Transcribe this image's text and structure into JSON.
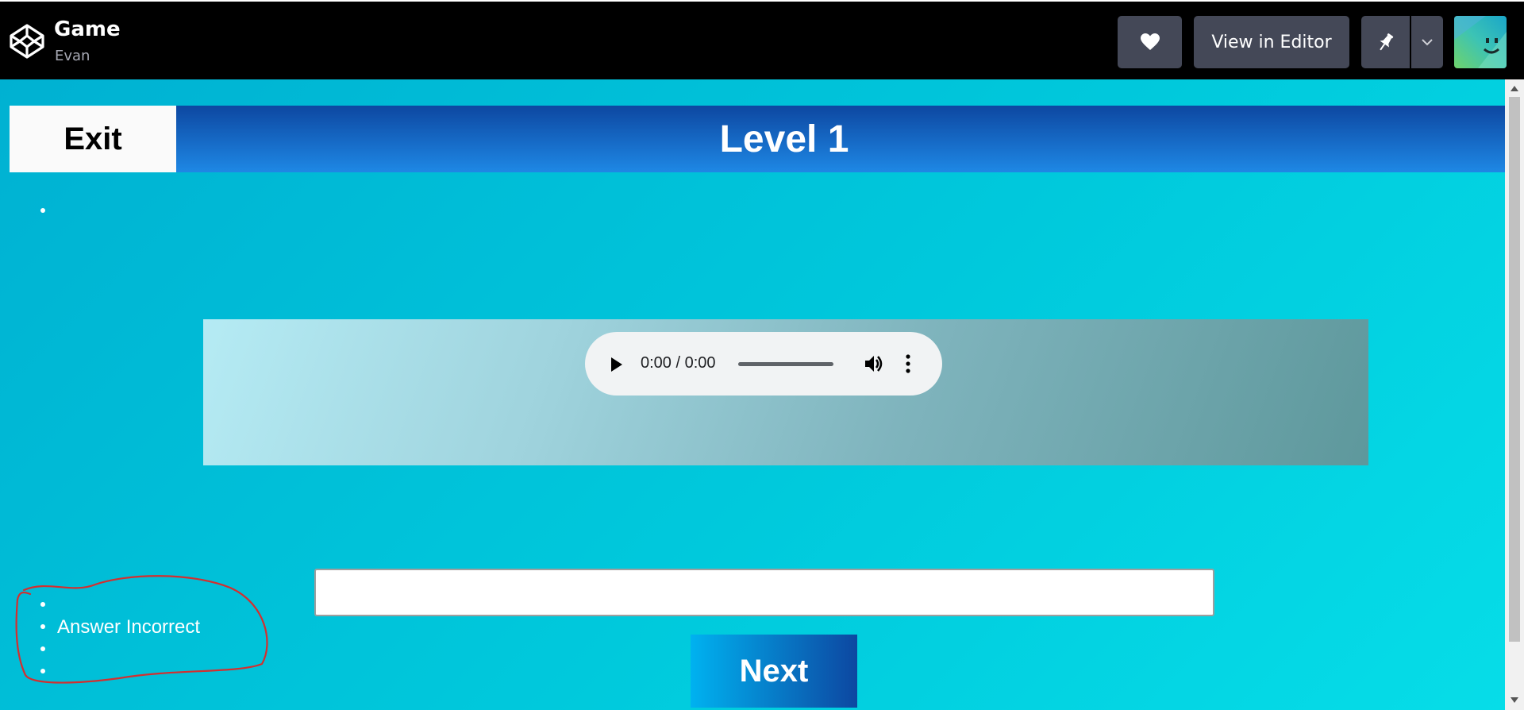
{
  "topbar": {
    "title": "Game",
    "author": "Evan",
    "heart_icon": "heart-icon",
    "view_in_editor": "View in Editor",
    "pin_icon": "pin-icon",
    "dropdown_icon": "chevron-down-icon"
  },
  "game": {
    "exit_label": "Exit",
    "level_title": "Level 1",
    "audio": {
      "time": "0:00 / 0:00"
    },
    "answer_input": {
      "value": "",
      "placeholder": ""
    },
    "next_label": "Next",
    "feedback": {
      "items": [
        "",
        "Answer Incorrect",
        "",
        ""
      ]
    }
  },
  "colors": {
    "topbar_bg": "#000000",
    "button_bg": "#444857",
    "stage_bg": "#00c0d8",
    "header_band": "#1565c0",
    "annotation": "#d32f2f"
  }
}
